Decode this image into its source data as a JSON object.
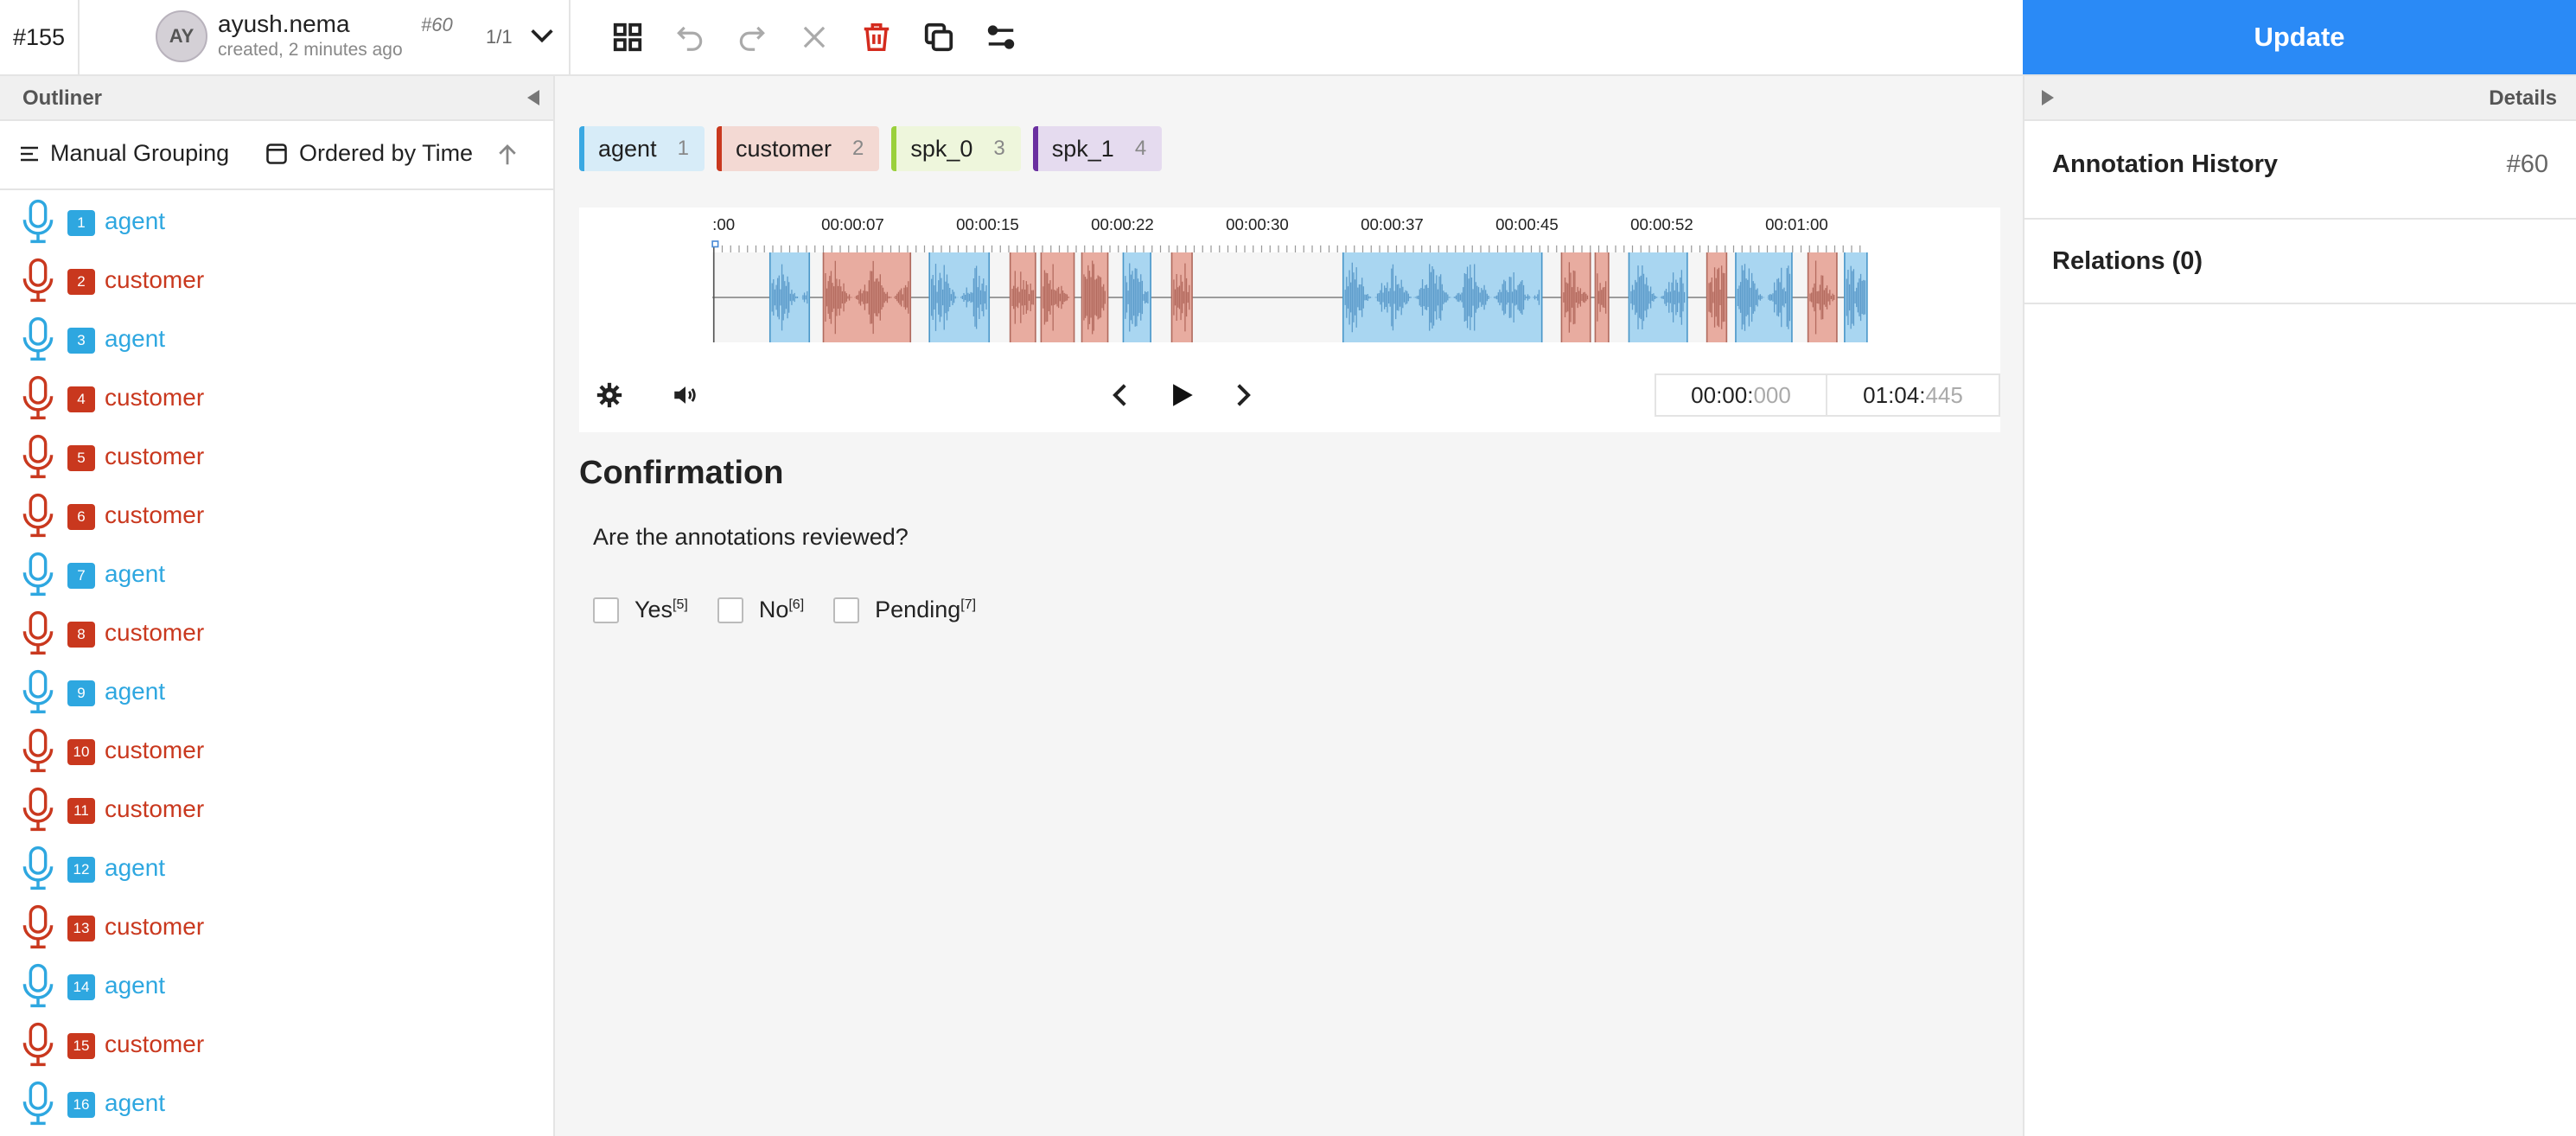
{
  "header": {
    "task_id": "#155",
    "avatar_initials": "AY",
    "user_name": "ayush.nema",
    "created": "created, 2 minutes ago",
    "annotation_id": "#60",
    "annotation_count": "1/1",
    "update_label": "Update",
    "toolbar_icons": [
      "grid-icon",
      "undo-icon",
      "redo-icon",
      "reset-icon",
      "delete-icon",
      "duplicate-icon",
      "settings-toggle-icon"
    ]
  },
  "outliner": {
    "title": "Outliner",
    "grouping_label": "Manual Grouping",
    "ordering_label": "Ordered by Time",
    "regions": [
      {
        "idx": "1",
        "label": "agent",
        "type": "agent"
      },
      {
        "idx": "2",
        "label": "customer",
        "type": "customer"
      },
      {
        "idx": "3",
        "label": "agent",
        "type": "agent"
      },
      {
        "idx": "4",
        "label": "customer",
        "type": "customer"
      },
      {
        "idx": "5",
        "label": "customer",
        "type": "customer"
      },
      {
        "idx": "6",
        "label": "customer",
        "type": "customer"
      },
      {
        "idx": "7",
        "label": "agent",
        "type": "agent"
      },
      {
        "idx": "8",
        "label": "customer",
        "type": "customer"
      },
      {
        "idx": "9",
        "label": "agent",
        "type": "agent"
      },
      {
        "idx": "10",
        "label": "customer",
        "type": "customer"
      },
      {
        "idx": "11",
        "label": "customer",
        "type": "customer"
      },
      {
        "idx": "12",
        "label": "agent",
        "type": "agent"
      },
      {
        "idx": "13",
        "label": "customer",
        "type": "customer"
      },
      {
        "idx": "14",
        "label": "agent",
        "type": "agent"
      },
      {
        "idx": "15",
        "label": "customer",
        "type": "customer"
      },
      {
        "idx": "16",
        "label": "agent",
        "type": "agent"
      }
    ]
  },
  "labels": [
    {
      "name": "agent",
      "hotkey": "1",
      "bg": "#d7ecf8",
      "border": "#3aa8e2"
    },
    {
      "name": "customer",
      "hotkey": "2",
      "bg": "#f3d9d3",
      "border": "#c9381e"
    },
    {
      "name": "spk_0",
      "hotkey": "3",
      "bg": "#eef6dc",
      "border": "#9ad03c"
    },
    {
      "name": "spk_1",
      "hotkey": "4",
      "bg": "#e5dbef",
      "border": "#6a2fa0"
    }
  ],
  "timeline": {
    "tick_labels": [
      ":00",
      "00:00:07",
      "00:00:15",
      "00:00:22",
      "00:00:30",
      "00:00:37",
      "00:00:45",
      "00:00:52",
      "00:01:00"
    ],
    "agent_color": "#a9d6f1",
    "customer_color": "#e8aca0"
  },
  "player": {
    "current_time": "00:00:",
    "current_ms": "000",
    "duration_time": "01:04:",
    "duration_ms": "445"
  },
  "confirmation": {
    "title": "Confirmation",
    "question": "Are the annotations reviewed?",
    "choices": [
      {
        "label": "Yes",
        "hotkey": "[5]"
      },
      {
        "label": "No",
        "hotkey": "[6]"
      },
      {
        "label": "Pending",
        "hotkey": "[7]"
      }
    ]
  },
  "details": {
    "title": "Details",
    "history_label": "Annotation History",
    "history_id": "#60",
    "relations_label": "Relations (0)"
  },
  "colors": {
    "accent": "#2a8af6",
    "agent": "#2ea7e0",
    "customer": "#c9381e"
  }
}
